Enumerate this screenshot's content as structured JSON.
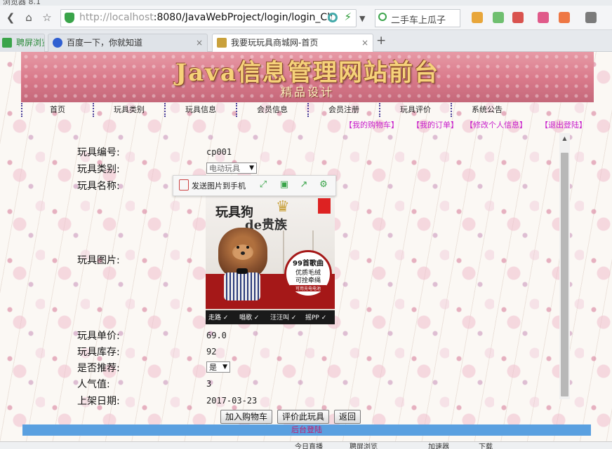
{
  "window": {
    "title_partial": "浏览器 8.1"
  },
  "address_bar": {
    "url_host": "http://localhost",
    "url_rest": ":8080/JavaWebProject/login/login_Che",
    "search_text": "二手车上瓜子"
  },
  "tabs": [
    {
      "label": "聘屏浏览",
      "active": false
    },
    {
      "label": "百度一下，你就知道",
      "active": false,
      "close": "×"
    },
    {
      "label": "我要玩玩具商城网-首页",
      "active": true,
      "close": "×"
    }
  ],
  "new_tab": "+",
  "banner": {
    "title": "Java信息管理网站前台",
    "subtitle": "精品设计"
  },
  "nav": [
    "首页",
    "玩具类别",
    "玩具信息",
    "会员信息",
    "会员注册",
    "玩具评价",
    "系统公告"
  ],
  "subnav": [
    "【我的购物车】",
    "【我的订单】",
    "【修改个人信息】",
    "【退出登陆】"
  ],
  "details": {
    "labels": {
      "code": "玩具编号:",
      "category": "玩具类别:",
      "name": "玩具名称:",
      "image": "玩具图片:",
      "price": "玩具单价:",
      "stock": "玩具库存:",
      "recommend": "是否推荐:",
      "popularity": "人气值:",
      "date": "上架日期:"
    },
    "values": {
      "code": "cp001",
      "category": "电动玩具",
      "price": "69.0",
      "stock": "92",
      "recommend": "是",
      "popularity": "3",
      "date": "2017-03-23"
    }
  },
  "product_image": {
    "title1": "玩具狗",
    "title2": "de贵族",
    "circle_line1": "99首歌曲",
    "circle_line2": "优质毛绒",
    "circle_line3": "可拴牵绳",
    "circle_line4": "可用充电电池",
    "features": [
      "走路 ✓",
      "唱歌 ✓",
      "汪汪叫 ✓",
      "摇PP ✓"
    ]
  },
  "image_toolbar": {
    "send_label": "发送图片到手机"
  },
  "buttons": {
    "add_cart": "加入购物车",
    "review": "评价此玩具",
    "back": "返回"
  },
  "footer": {
    "admin_link": "后台登陆"
  },
  "statusbar": [
    "今日直播",
    "聘屏浏览",
    "加速器",
    "下载"
  ]
}
